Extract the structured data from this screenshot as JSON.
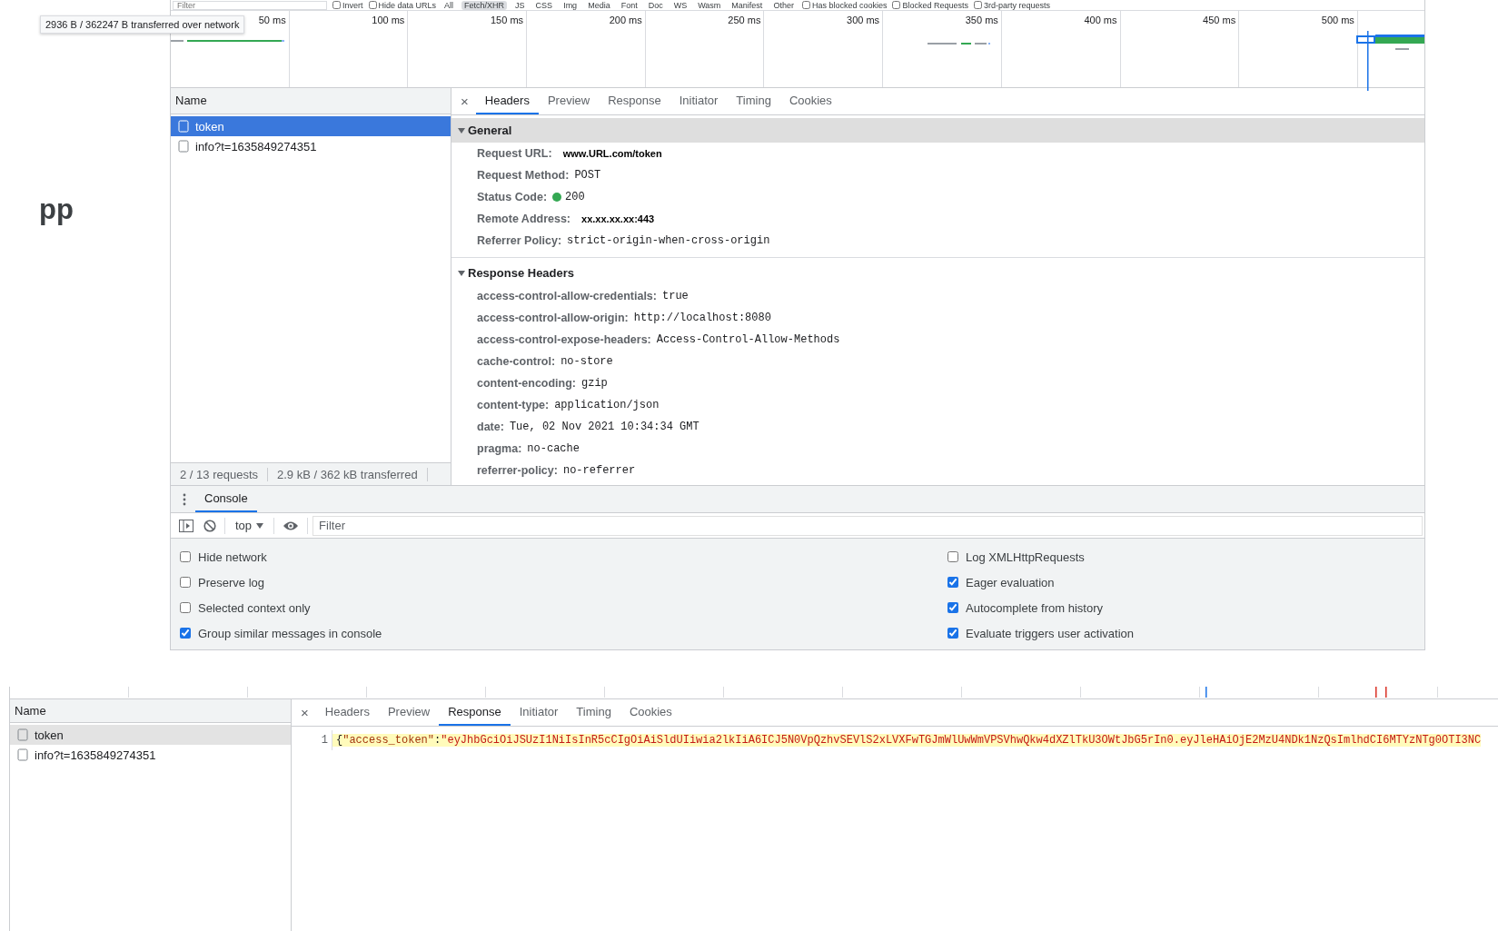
{
  "page_text": "pp",
  "tooltip": "2936 B / 362247 B transferred over network",
  "network_filter_bar": {
    "filter_placeholder": "Filter",
    "options": [
      {
        "label": "Invert",
        "checked": false
      },
      {
        "label": "Hide data URLs",
        "checked": false
      }
    ],
    "types": [
      {
        "label": "All",
        "selected": false
      },
      {
        "label": "Fetch/XHR",
        "selected": true
      },
      {
        "label": "JS",
        "selected": false
      },
      {
        "label": "CSS",
        "selected": false
      },
      {
        "label": "Img",
        "selected": false
      },
      {
        "label": "Media",
        "selected": false
      },
      {
        "label": "Font",
        "selected": false
      },
      {
        "label": "Doc",
        "selected": false
      },
      {
        "label": "WS",
        "selected": false
      },
      {
        "label": "Wasm",
        "selected": false
      },
      {
        "label": "Manifest",
        "selected": false
      },
      {
        "label": "Other",
        "selected": false
      }
    ],
    "extra_options": [
      {
        "label": "Has blocked cookies",
        "checked": false
      },
      {
        "label": "Blocked Requests",
        "checked": false
      },
      {
        "label": "3rd-party requests",
        "checked": false
      }
    ]
  },
  "overview": {
    "ticks": [
      "50 ms",
      "100 ms",
      "150 ms",
      "200 ms",
      "250 ms",
      "300 ms",
      "350 ms",
      "400 ms",
      "450 ms",
      "500 ms"
    ]
  },
  "requests": {
    "column": "Name",
    "rows": [
      {
        "name": "token",
        "selected": true
      },
      {
        "name": "info?t=1635849274351",
        "selected": false
      }
    ],
    "status": [
      "2 / 13 requests",
      "2.9 kB / 362 kB transferred"
    ]
  },
  "details": {
    "close": "×",
    "tabs": [
      {
        "label": "Headers",
        "selected": true
      },
      {
        "label": "Preview",
        "selected": false
      },
      {
        "label": "Response",
        "selected": false
      },
      {
        "label": "Initiator",
        "selected": false
      },
      {
        "label": "Timing",
        "selected": false
      },
      {
        "label": "Cookies",
        "selected": false
      }
    ],
    "sections": [
      {
        "title": "General",
        "expanded": true,
        "rows": [
          {
            "name": "Request URL:",
            "value": "www.URL.com/token",
            "kind": "emphasis"
          },
          {
            "name": "Request Method:",
            "value": "POST",
            "kind": "code"
          },
          {
            "name": "Status Code:",
            "value": "200",
            "kind": "status"
          },
          {
            "name": "Remote Address:",
            "value": "xx.xx.xx.xx:443",
            "kind": "emphasis"
          },
          {
            "name": "Referrer Policy:",
            "value": "strict-origin-when-cross-origin",
            "kind": "code"
          }
        ]
      },
      {
        "title": "Response Headers",
        "expanded": true,
        "rows": [
          {
            "name": "access-control-allow-credentials:",
            "value": "true",
            "kind": "code"
          },
          {
            "name": "access-control-allow-origin:",
            "value": "http://localhost:8080",
            "kind": "code"
          },
          {
            "name": "access-control-expose-headers:",
            "value": "Access-Control-Allow-Methods",
            "kind": "code"
          },
          {
            "name": "cache-control:",
            "value": "no-store",
            "kind": "code"
          },
          {
            "name": "content-encoding:",
            "value": "gzip",
            "kind": "code"
          },
          {
            "name": "content-type:",
            "value": "application/json",
            "kind": "code"
          },
          {
            "name": "date:",
            "value": "Tue, 02 Nov 2021 10:34:34 GMT",
            "kind": "code"
          },
          {
            "name": "pragma:",
            "value": "no-cache",
            "kind": "code"
          },
          {
            "name": "referrer-policy:",
            "value": "no-referrer",
            "kind": "code"
          }
        ]
      }
    ]
  },
  "console_drawer": {
    "tabs": [
      {
        "label": "Console",
        "selected": true
      }
    ],
    "context": "top",
    "filter_placeholder": "Filter",
    "settings": {
      "column_1": [
        {
          "label": "Hide network",
          "checked": false
        },
        {
          "label": "Preserve log",
          "checked": false
        },
        {
          "label": "Selected context only",
          "checked": false
        },
        {
          "label": "Group similar messages in console",
          "checked": true
        }
      ],
      "column_2": [
        {
          "label": "Log XMLHttpRequests",
          "checked": false
        },
        {
          "label": "Eager evaluation",
          "checked": true
        },
        {
          "label": "Autocomplete from history",
          "checked": true
        },
        {
          "label": "Evaluate triggers user activation",
          "checked": true
        }
      ]
    }
  },
  "second_view": {
    "requests": {
      "column": "Name",
      "rows": [
        {
          "name": "token",
          "selected": true
        },
        {
          "name": "info?t=1635849274351",
          "selected": false
        }
      ]
    },
    "close": "×",
    "tabs": [
      {
        "label": "Headers",
        "selected": false
      },
      {
        "label": "Preview",
        "selected": false
      },
      {
        "label": "Response",
        "selected": true
      },
      {
        "label": "Initiator",
        "selected": false
      },
      {
        "label": "Timing",
        "selected": false
      },
      {
        "label": "Cookies",
        "selected": false
      }
    ],
    "response_lines": [
      {
        "line_number": "1",
        "highlighted": true,
        "tokens": [
          {
            "text": "{",
            "kind": "punct"
          },
          {
            "text": "\"access_token\"",
            "kind": "key"
          },
          {
            "text": ":",
            "kind": "punct"
          },
          {
            "text": "\"eyJhbGciOiJSUzI1NiIsInR5cCIgOiAiSldUIiwia2lkIiA6ICJ5N0VpQzhvSEVlS2xLVXFwTGJmWlUwWmVPSVhwQkw4dXZlTkU3OWtJbG5rIn0.eyJleHAiOjE2MzU4NDk1NzQsImlhdCI6MTYzNTg0OTI3NC",
            "kind": "string"
          }
        ]
      }
    ]
  }
}
